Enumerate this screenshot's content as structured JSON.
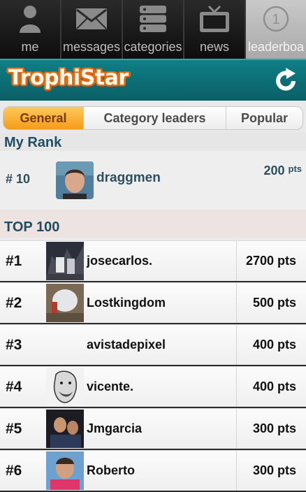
{
  "tabs": [
    {
      "label": "me",
      "icon": "person-icon",
      "active": false
    },
    {
      "label": "messages",
      "icon": "envelope-icon",
      "active": false
    },
    {
      "label": "categories",
      "icon": "stack-icon",
      "active": false
    },
    {
      "label": "news",
      "icon": "tv-icon",
      "active": false
    },
    {
      "label": "leaderboa",
      "icon": "rank-circle-icon",
      "active": true,
      "icon_text": "1"
    }
  ],
  "header": {
    "logo_text": "TrophiStar",
    "refresh_icon": "refresh-icon"
  },
  "segments": [
    {
      "label": "General",
      "active": true
    },
    {
      "label": "Category leaders",
      "active": false
    },
    {
      "label": "Popular",
      "active": false
    }
  ],
  "my_rank": {
    "title": "My Rank",
    "rank": "# 10",
    "username": "draggmen",
    "points": "200",
    "points_unit": "pts"
  },
  "top100": {
    "title": "TOP 100",
    "rows": [
      {
        "rank": "#1",
        "username": "josecarlos.",
        "points": "2700 pts",
        "avatar": "photo-icon"
      },
      {
        "rank": "#2",
        "username": "Lostkingdom",
        "points": "500 pts",
        "avatar": "photo-icon"
      },
      {
        "rank": "#3",
        "username": "avistadepixel",
        "points": "400 pts",
        "avatar": ""
      },
      {
        "rank": "#4",
        "username": "vicente.",
        "points": "400 pts",
        "avatar": "photo-icon"
      },
      {
        "rank": "#5",
        "username": "Jmgarcia",
        "points": "300 pts",
        "avatar": "photo-icon"
      },
      {
        "rank": "#6",
        "username": "Roberto",
        "points": "300 pts",
        "avatar": "photo-icon"
      }
    ]
  },
  "colors": {
    "header_teal": "#0f7f86",
    "accent_orange": "#f49b1a",
    "text_dark": "#2f4e5f"
  }
}
